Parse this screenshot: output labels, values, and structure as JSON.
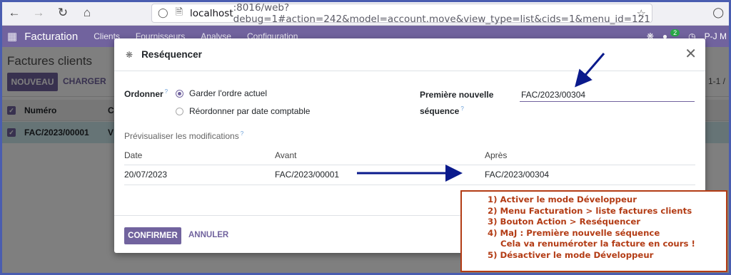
{
  "browser": {
    "url_host": "localhost",
    "url_rest": ":8016/web?debug=1#action=242&model=account.move&view_type=list&cids=1&menu_id=121"
  },
  "navbar": {
    "app_title": "Facturation",
    "menus": [
      "Clients",
      "Fournisseurs",
      "Analyse",
      "Configuration"
    ],
    "messages_count": "2",
    "user": "P-J M"
  },
  "control_panel": {
    "breadcrumb": "Factures clients",
    "new_label": "NOUVEAU",
    "upload_label": "CHARGER",
    "pager": "1-1 /"
  },
  "list": {
    "header_number": "Numéro",
    "header_col2": "C",
    "row_number": "FAC/2023/00001",
    "row_col2": "V"
  },
  "dialog": {
    "title": "Reséquencer",
    "order_label": "Ordonner",
    "order_options": [
      "Garder l'ordre actuel",
      "Réordonner par date comptable"
    ],
    "first_seq_label": "Première nouvelle séquence",
    "first_seq_value": "FAC/2023/00304",
    "preview_label": "Prévisualiser les modifications",
    "table_headers": [
      "Date",
      "Avant",
      "Après"
    ],
    "table_rows": [
      {
        "date": "20/07/2023",
        "avant": "FAC/2023/00001",
        "apres": "FAC/2023/00304"
      }
    ],
    "confirm_label": "CONFIRMER",
    "cancel_label": "ANNULER"
  },
  "annotation": {
    "lines": [
      "1) Activer le mode Développeur",
      "2) Menu Facturation >  liste factures clients",
      "3) Bouton Action > Reséquencer",
      "4) MaJ : Première nouvelle séquence",
      "Cela va renuméroter la facture en cours !",
      "5) Désactiver le mode Développeur"
    ],
    "color": "#b33c15"
  },
  "colors": {
    "primary": "#71639e",
    "arrow": "#0a1a8c"
  }
}
